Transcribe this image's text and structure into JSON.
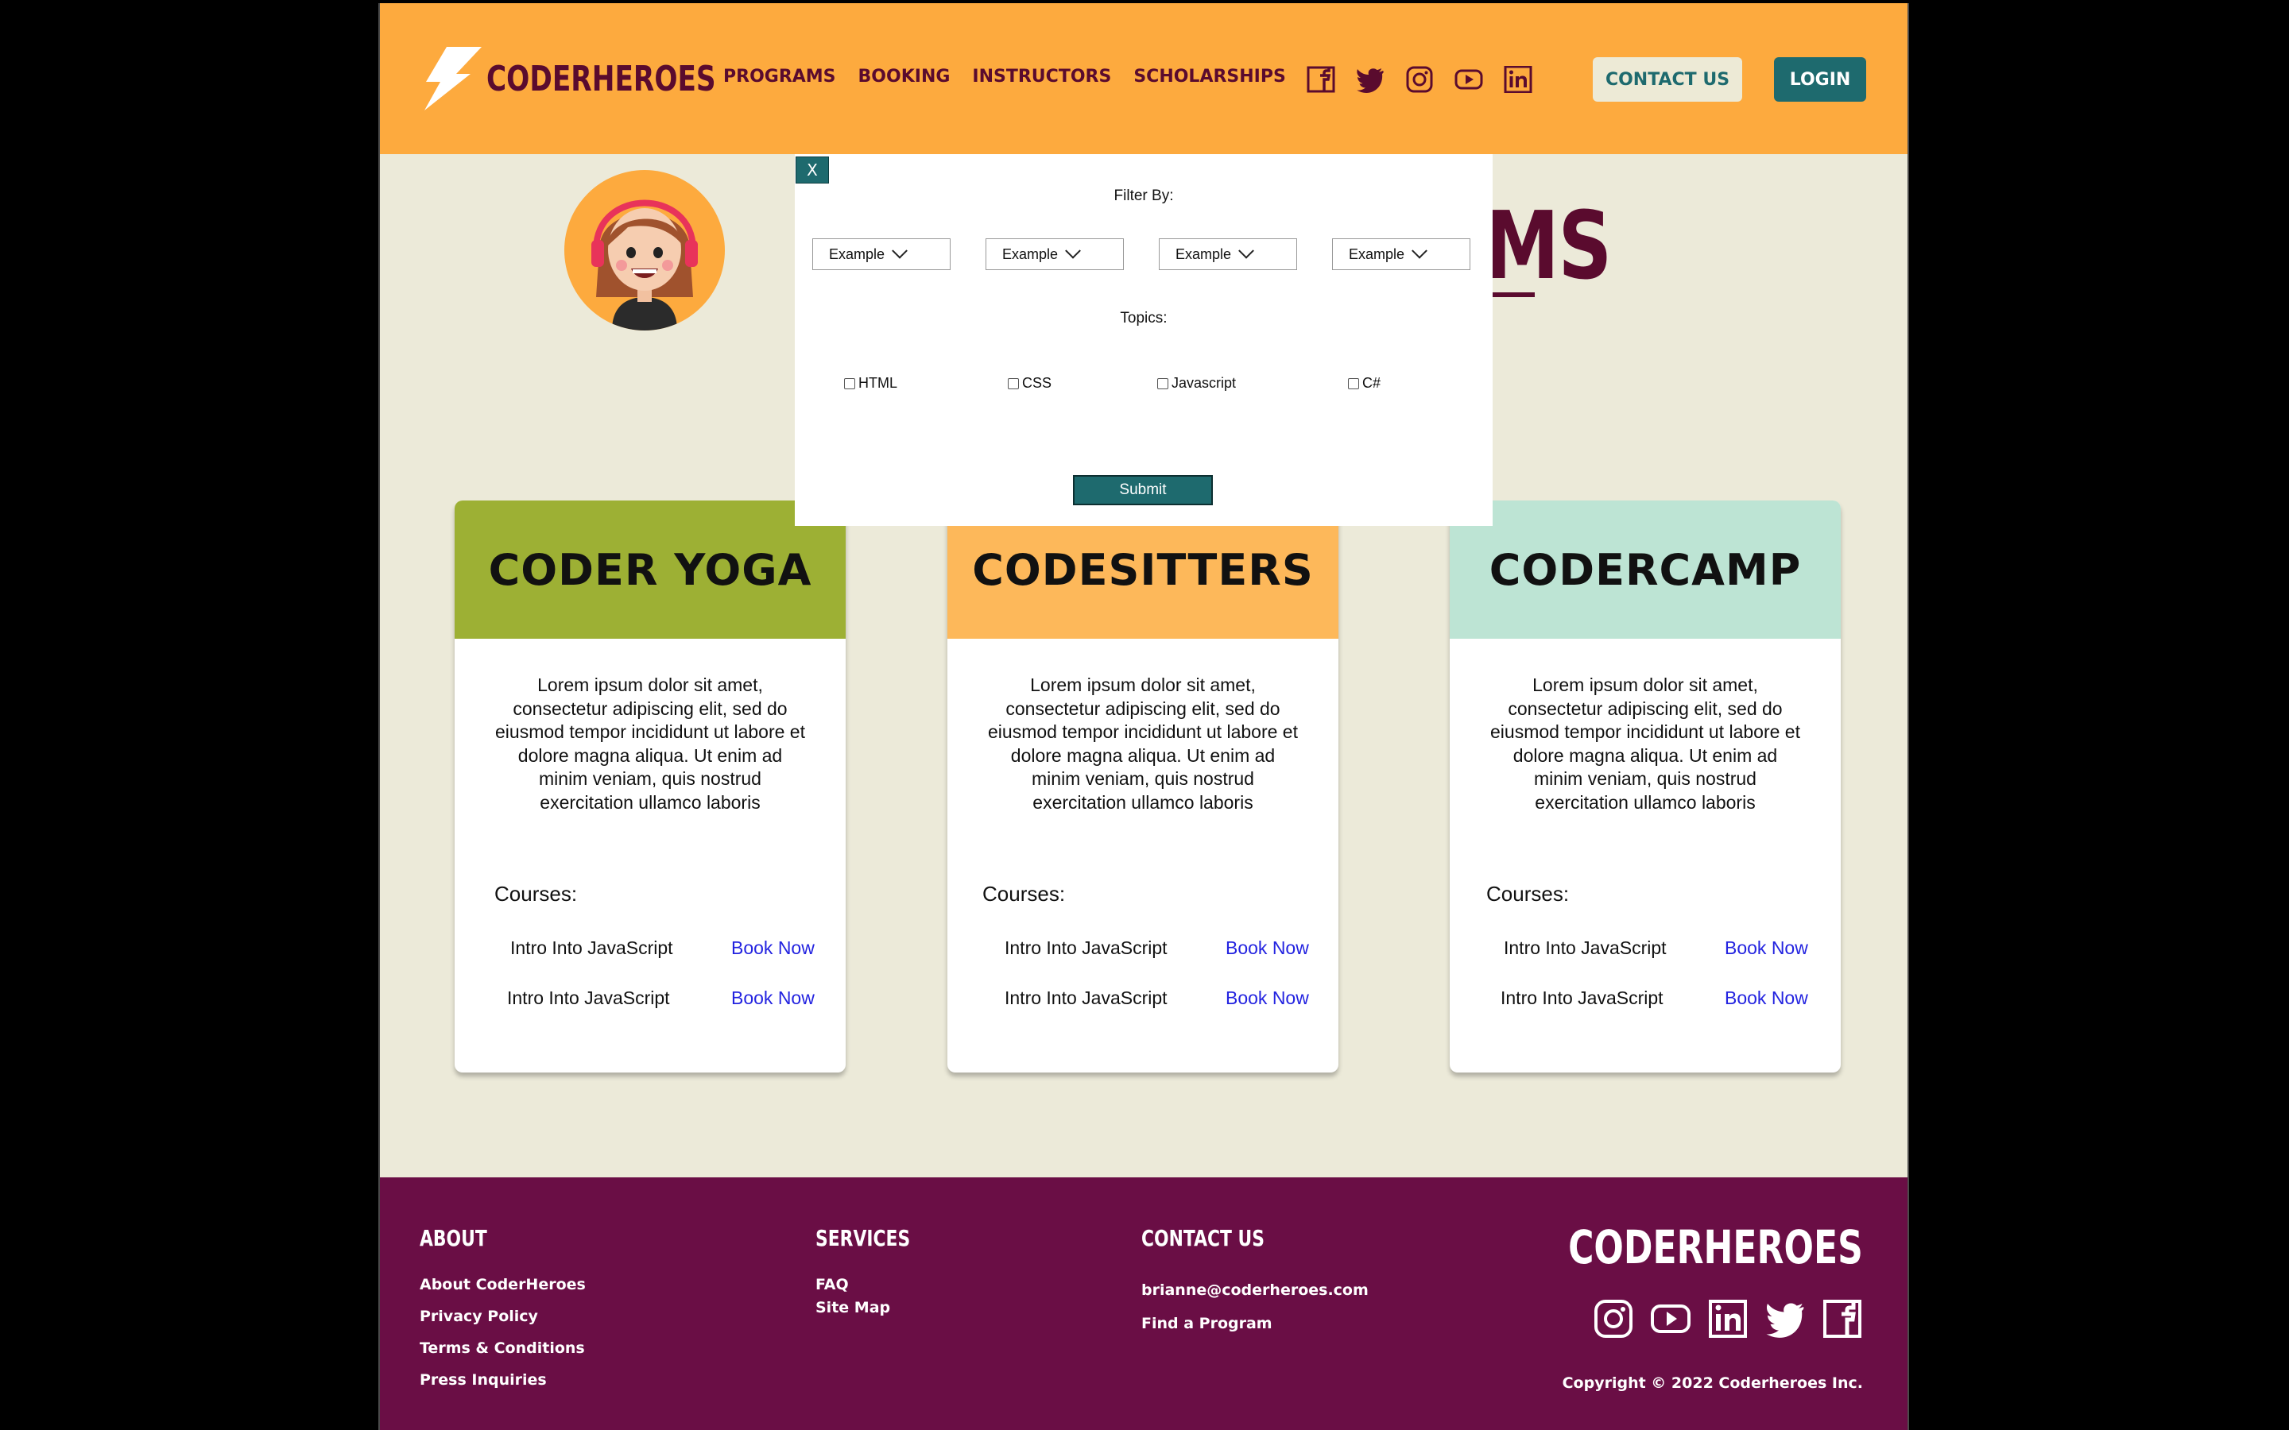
{
  "header": {
    "logo_text": "CODERHEROES",
    "nav": [
      "PROGRAMS",
      "BOOKING",
      "INSTRUCTORS",
      "SCHOLARSHIPS"
    ],
    "social_icons": [
      "facebook-icon",
      "twitter-icon",
      "instagram-icon",
      "youtube-icon",
      "linkedin-icon"
    ],
    "contact_label": "CONTACT US",
    "login_label": "LOGIN"
  },
  "hero": {
    "title_visible_fragment": "MS"
  },
  "modal": {
    "close_label": "X",
    "filter_label": "Filter By:",
    "selects": [
      "Example",
      "Example",
      "Example",
      "Example"
    ],
    "topics_label": "Topics:",
    "topics": [
      "HTML",
      "CSS",
      "Javascript",
      "C#"
    ],
    "submit_label": "Submit"
  },
  "cards": [
    {
      "title": "CODER YOGA",
      "color": "#9DB034",
      "description": "Lorem ipsum dolor sit amet, consectetur adipiscing elit, sed do eiusmod tempor incididunt ut labore et dolore magna aliqua. Ut enim ad minim veniam, quis nostrud exercitation ullamco laboris",
      "courses_label": "Courses:",
      "courses": [
        {
          "name": "Intro Into JavaScript",
          "action": "Book Now"
        },
        {
          "name": "Intro Into JavaScript",
          "action": "Book Now"
        }
      ]
    },
    {
      "title": "CODESITTERS",
      "color": "#FDB85A",
      "description": "Lorem ipsum dolor sit amet, consectetur adipiscing elit, sed do eiusmod tempor incididunt ut labore et dolore magna aliqua. Ut enim ad minim veniam, quis nostrud exercitation ullamco laboris",
      "courses_label": "Courses:",
      "courses": [
        {
          "name": "Intro Into JavaScript",
          "action": "Book Now"
        },
        {
          "name": "Intro Into JavaScript",
          "action": "Book Now"
        }
      ]
    },
    {
      "title": "CODERCAMP",
      "color": "#BDE4D4",
      "description": "Lorem ipsum dolor sit amet, consectetur adipiscing elit, sed do eiusmod tempor incididunt ut labore et dolore magna aliqua. Ut enim ad minim veniam, quis nostrud exercitation ullamco laboris",
      "courses_label": "Courses:",
      "courses": [
        {
          "name": "Intro Into JavaScript",
          "action": "Book Now"
        },
        {
          "name": "Intro Into JavaScript",
          "action": "Book Now"
        }
      ]
    }
  ],
  "footer": {
    "about": {
      "heading": "ABOUT",
      "links": [
        "About CoderHeroes",
        "Privacy Policy",
        "Terms & Conditions",
        "Press Inquiries"
      ]
    },
    "services": {
      "heading": "SERVICES",
      "links": [
        "FAQ",
        "Site Map"
      ]
    },
    "contact": {
      "heading": "CONTACT US",
      "links": [
        "brianne@coderheroes.com",
        "Find a Program"
      ]
    },
    "brand": "CODERHEROES",
    "social_icons": [
      "instagram-icon",
      "youtube-icon",
      "linkedin-icon",
      "twitter-icon",
      "facebook-icon"
    ],
    "copyright": "Copyright © 2022 Coderheroes Inc."
  },
  "colors": {
    "header_bg": "#FDAA3E",
    "page_bg": "#ECEAD9",
    "brand_maroon": "#5A0B2E",
    "teal": "#1E6A6E",
    "footer_bg": "#6A0E45",
    "link_blue": "#2323E0"
  }
}
